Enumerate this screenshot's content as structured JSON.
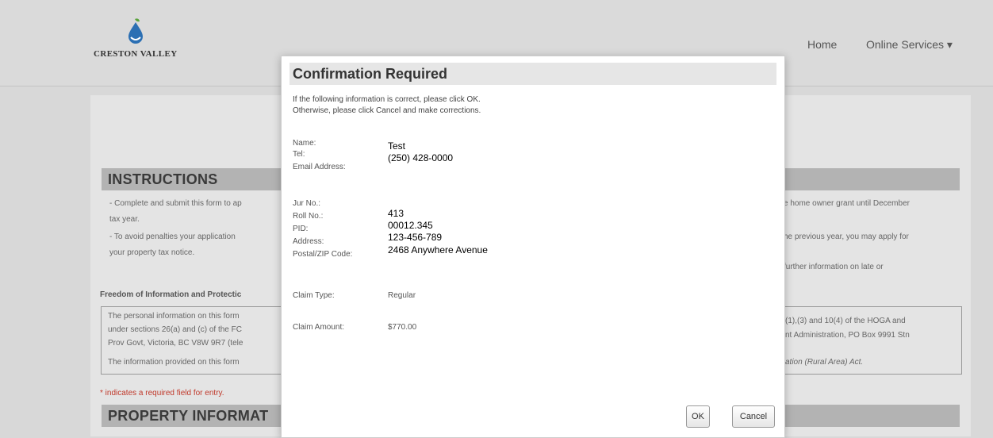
{
  "header": {
    "logo_text": "CRESTON VALLEY",
    "nav": {
      "home": "Home",
      "online_services": "Online Services ▾"
    }
  },
  "page": {
    "instructions_title": "INSTRUCTIONS",
    "instructions_left": [
      "- Complete and submit this form to ap",
      "tax year.",
      "- To avoid penalties your application",
      "your property tax notice."
    ],
    "instructions_right": [
      "e home owner grant until December",
      "",
      "he previous year, you may apply for",
      "",
      "further information on late or"
    ],
    "foi_heading": "Freedom of Information and Protectic",
    "foi_left": [
      "The personal information on this form",
      "under sections 26(a) and (c) of the FC",
      "Prov Govt, Victoria, BC V8W 9R7 (tele",
      "The information provided on this form"
    ],
    "foi_right": [
      "(1),(3) and 10(4) of the HOGA and",
      "nt Administration, PO Box 9991 Stn",
      "",
      "ation (Rural Area) Act."
    ],
    "required_note": "* indicates a required field for entry.",
    "property_title": "PROPERTY INFORMAT"
  },
  "modal": {
    "title": "Confirmation Required",
    "intro_line1": "If the following information is correct, please click OK.",
    "intro_line2": "Otherwise, please click Cancel and make corrections.",
    "labels": {
      "name": "Name:",
      "tel": "Tel:",
      "email": "Email Address:",
      "jur": "Jur No.:",
      "roll": "Roll No.:",
      "pid": "PID:",
      "address": "Address:",
      "postal": "Postal/ZIP Code:",
      "claim_type": "Claim Type:",
      "claim_amount": "Claim Amount:"
    },
    "values": {
      "name": "Test",
      "tel": "(250) 428-0000",
      "jur": "413",
      "roll": "00012.345",
      "pid": "123-456-789",
      "address": "2468 Anywhere Avenue",
      "claim_type": "Regular",
      "claim_amount": "$770.00"
    },
    "ok_label": "OK",
    "cancel_label": "Cancel"
  },
  "colors": {
    "modal_header": "#e6e6e6",
    "section_bar": "#b3b3b3",
    "required": "#c0392b",
    "logo_blue": "#2b6fb3",
    "logo_green": "#5aa33c"
  }
}
